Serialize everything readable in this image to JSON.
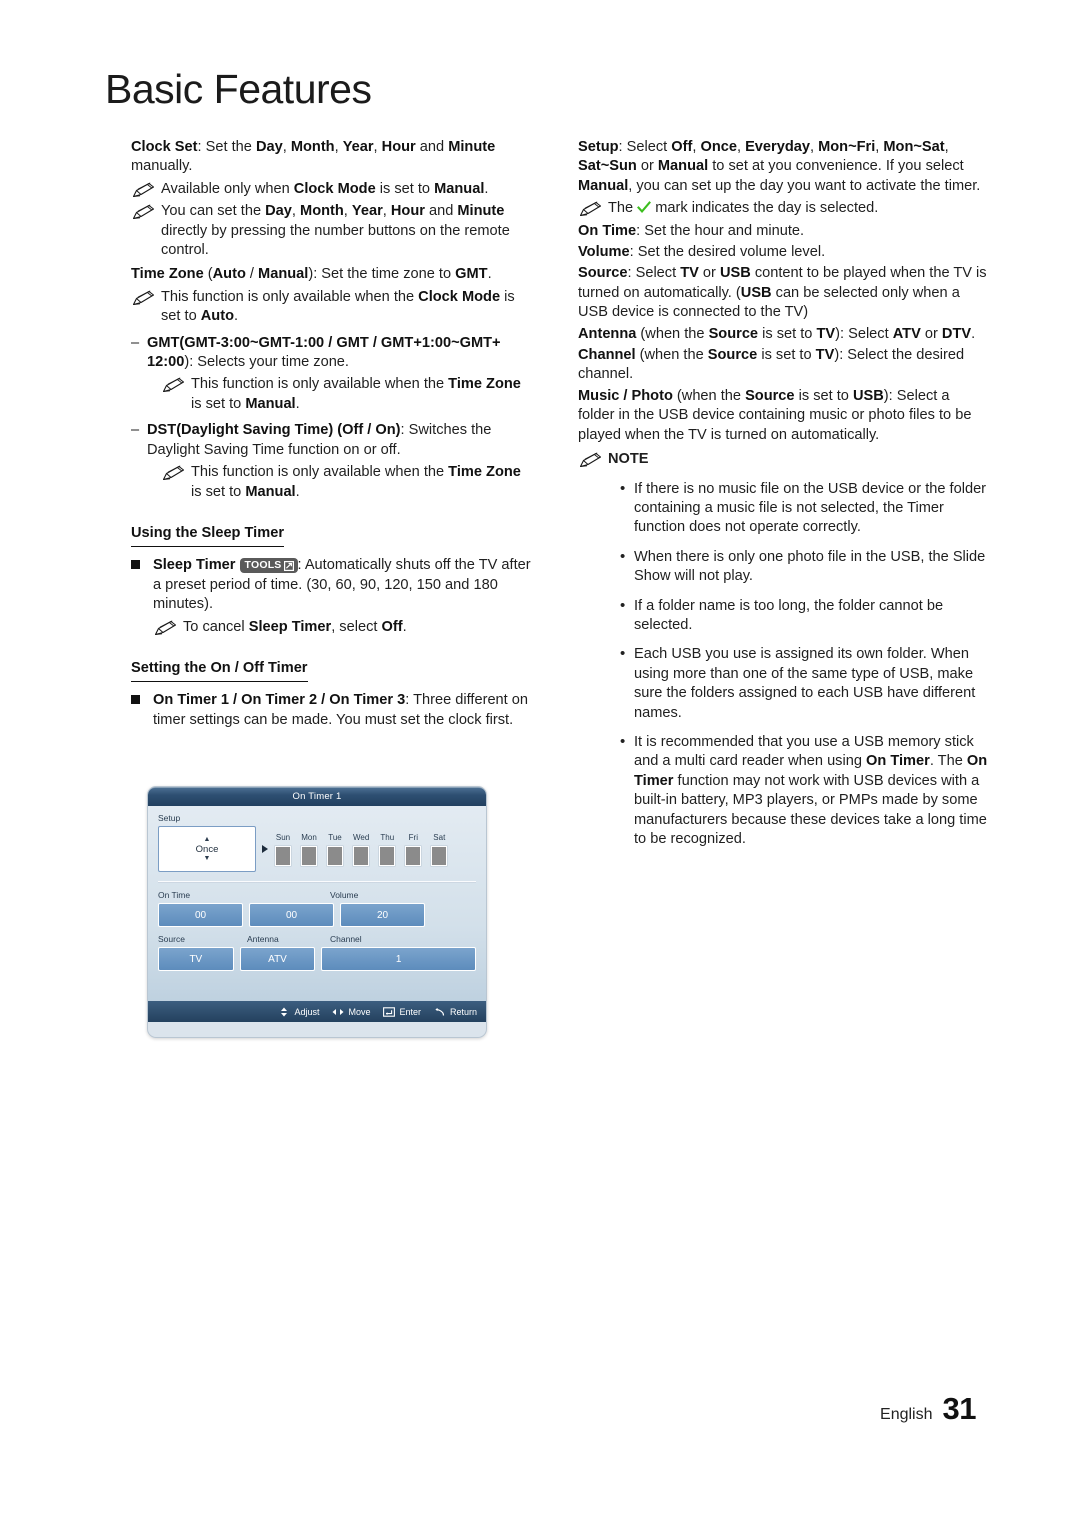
{
  "page": {
    "title": "Basic Features",
    "footer_language": "English",
    "footer_page_number": "31"
  },
  "left_column": {
    "clock_set": {
      "lead_bold": "Clock Set",
      "text_1": ": Set the ",
      "b_day": "Day",
      "t_c1": ", ",
      "b_month": "Month",
      "t_c2": ", ",
      "b_year": "Year",
      "t_c3": ", ",
      "b_hour": "Hour",
      "t_and": " and ",
      "b_minute": "Minute",
      "t_tail": " manually."
    },
    "note_clock_mode": {
      "t1": "Available only when ",
      "b1": "Clock Mode",
      "t2": " is set to ",
      "b2": "Manual",
      "t3": "."
    },
    "note_set_directly": {
      "t1": "You can set the ",
      "b_day": "Day",
      "t2": ", ",
      "b_month": "Month",
      "t3": ", ",
      "b_year": "Year",
      "t4": ", ",
      "b_hour": "Hour",
      "t5": " and ",
      "b_minute": "Minute",
      "t6": " directly by pressing the number buttons on the remote control."
    },
    "time_zone": {
      "b_lead": "Time Zone",
      "t1": " (",
      "b_auto": "Auto",
      "t2": " / ",
      "b_manual": "Manual",
      "t3": "): Set the time zone to ",
      "b_gmt": "GMT",
      "t4": "."
    },
    "note_clock_auto": {
      "t1": "This function is only available when the ",
      "b1": "Clock Mode",
      "t2": " is set to ",
      "b2": "Auto",
      "t3": "."
    },
    "gmt_item": {
      "dash": "–",
      "b_range": "GMT(GMT-3:00~GMT-1:00 / GMT / GMT+1:00~GMT+ 12:00",
      "t_tail": "): Selects your time zone."
    },
    "note_timezone_manual_1": {
      "t1": "This function is only available when the ",
      "b1": "Time Zone",
      "t2": " is set to ",
      "b2": "Manual",
      "t3": "."
    },
    "dst_item": {
      "dash": "–",
      "b_dst": "DST(Daylight Saving Time) (Off / On)",
      "t_tail": ": Switches the Daylight Saving Time function on or off."
    },
    "note_timezone_manual_2": {
      "t1": "This function is only available when the ",
      "b1": "Time Zone",
      "t2": " is set to ",
      "b2": "Manual",
      "t3": "."
    },
    "heading_sleep_timer": "Using the Sleep Timer",
    "sleep_timer": {
      "b_lead": "Sleep Timer",
      "badge_label": "TOOLS",
      "t_tail": ": Automatically shuts off the TV after a preset period of time. (30, 60, 90, 120, 150 and 180 minutes)."
    },
    "note_cancel_sleep": {
      "t1": "To cancel ",
      "b1": "Sleep Timer",
      "t2": ", select ",
      "b2": "Off",
      "t3": "."
    },
    "heading_on_off_timer": "Setting the On / Off Timer",
    "on_timer": {
      "b_lead": "On Timer 1 / On Timer 2 / On Timer 3",
      "t_tail": ": Three different on timer settings can be made. You must set the clock first."
    }
  },
  "osd": {
    "title": "On Timer 1",
    "setup_label": "Setup",
    "setup_value": "Once",
    "days": [
      {
        "name": "Sun"
      },
      {
        "name": "Mon"
      },
      {
        "name": "Tue"
      },
      {
        "name": "Wed"
      },
      {
        "name": "Thu"
      },
      {
        "name": "Fri"
      },
      {
        "name": "Sat"
      }
    ],
    "on_time_label": "On Time",
    "volume_label": "Volume",
    "on_time_hour": "00",
    "on_time_minute": "00",
    "volume_value": "20",
    "source_label": "Source",
    "antenna_label": "Antenna",
    "channel_label": "Channel",
    "source_value": "TV",
    "antenna_value": "ATV",
    "channel_value": "1",
    "footer": {
      "adjust": "Adjust",
      "move": "Move",
      "enter": "Enter",
      "return": "Return"
    }
  },
  "right_column": {
    "setup": {
      "b_lead": "Setup",
      "t1": ": Select ",
      "b_off": "Off",
      "t2": ", ",
      "b_once": "Once",
      "t3": ", ",
      "b_everyday": "Everyday",
      "t4": ", ",
      "b_monfri": "Mon~Fri",
      "t5": ", ",
      "b_monsat": "Mon~Sat",
      "t6": ", ",
      "b_satsun": "Sat~Sun",
      "t7": " or ",
      "b_manual": "Manual",
      "t8": " to set at you convenience. If you select ",
      "b_manual2": "Manual",
      "t9": ", you can set up the day you want to activate the timer."
    },
    "note_check": {
      "t1": "The ",
      "check_color": "#3cbe1e",
      "t2": " mark indicates the day is selected."
    },
    "on_time": {
      "b_lead": "On Time",
      "t_tail": ": Set the hour and  minute."
    },
    "volume": {
      "b_lead": "Volume",
      "t_tail": ": Set the desired volume level."
    },
    "source": {
      "b_lead": "Source",
      "t1": ": Select ",
      "b_tv": "TV",
      "t2": " or ",
      "b_usb": "USB",
      "t3": " content to be played when the TV is turned on automatically. (",
      "b_usb2": "USB",
      "t4": " can be selected only when a USB device is connected to the TV)"
    },
    "antenna": {
      "b_lead": "Antenna",
      "t1": " (when the ",
      "b_source": "Source",
      "t2": " is set to ",
      "b_tv": "TV",
      "t3": "): Select ",
      "b_atv": "ATV",
      "t4": " or ",
      "b_dtv": "DTV",
      "t5": "."
    },
    "channel": {
      "b_lead": "Channel",
      "t1": " (when the ",
      "b_source": "Source",
      "t2": " is set to ",
      "b_tv": "TV",
      "t3": "): Select the desired channel."
    },
    "music_photo": {
      "b_lead": "Music / Photo",
      "t1": " (when the ",
      "b_source": "Source",
      "t2": " is set to ",
      "b_usb": "USB",
      "t3": "): Select a folder in the USB device containing music or photo files to be played when the TV is turned on automatically."
    },
    "note_heading": "NOTE",
    "note_bullets": [
      "If there is no music file on the USB device or the folder containing a music file is not selected, the Timer function does not operate correctly.",
      "When there is only one photo file in the USB, the Slide Show will not play.",
      "If a folder name is too long, the folder cannot be selected.",
      "Each USB you use is assigned its own folder. When using more than one of the same type of USB, make sure the folders assigned to each USB have different names."
    ],
    "note_last_bullet": {
      "t1": "It is recommended that you use a USB memory stick and a multi card reader when using ",
      "b1": "On Timer",
      "t2": ". The ",
      "b2": "On Timer",
      "t3": " function may not work with USB devices with a built-in battery, MP3 players, or PMPs made by some manufacturers because these devices take a long time to be recognized."
    }
  }
}
